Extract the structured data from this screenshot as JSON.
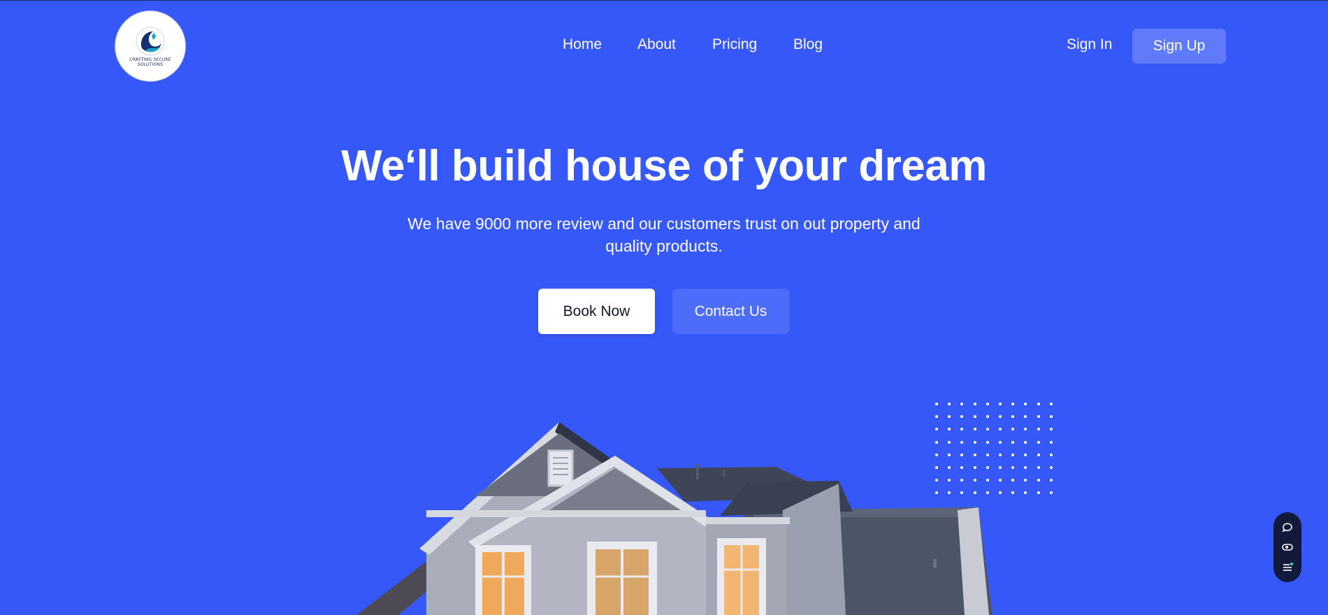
{
  "header": {
    "logo_text": "CRAFTING SECURE SOLUTIONS",
    "nav": [
      "Home",
      "About",
      "Pricing",
      "Blog"
    ],
    "sign_in": "Sign In",
    "sign_up": "Sign Up"
  },
  "hero": {
    "title": "We‘ll build house of your dream",
    "subtitle": "We have 9000 more review and our customers trust on out property and quality products.",
    "primary_button": "Book Now",
    "secondary_button": "Contact Us"
  },
  "widget": {
    "icons": [
      "chat-icon",
      "eye-icon",
      "menu-list-icon"
    ]
  },
  "colors": {
    "background": "#3758f9",
    "signup_button": "#5f7bfb",
    "contact_button": "#4e6cfa",
    "widget": "#111a3a"
  }
}
